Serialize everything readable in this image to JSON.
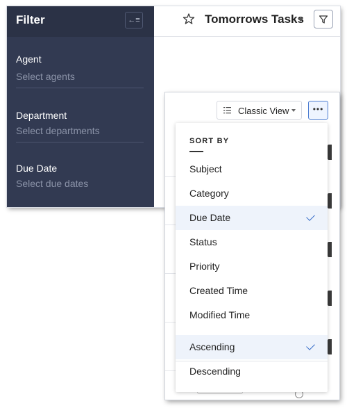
{
  "filter_panel": {
    "title": "Filter",
    "collapse_icon_text": "←≡",
    "fields": [
      {
        "label": "Agent",
        "placeholder": "Select agents"
      },
      {
        "label": "Department",
        "placeholder": "Select departments"
      },
      {
        "label": "Due Date",
        "placeholder": "Select due dates"
      }
    ]
  },
  "header": {
    "title": "Tomorrows Tasks",
    "star_icon": "star-icon",
    "filter_icon": "funnel-icon"
  },
  "toolbar": {
    "view_label": "Classic View",
    "more_label": "•••"
  },
  "sort_menu": {
    "heading": "SORT BY",
    "sort_fields": [
      {
        "label": "Subject",
        "selected": false
      },
      {
        "label": "Category",
        "selected": false
      },
      {
        "label": "Due Date",
        "selected": true
      },
      {
        "label": "Status",
        "selected": false
      },
      {
        "label": "Priority",
        "selected": false
      },
      {
        "label": "Created Time",
        "selected": false
      },
      {
        "label": "Modified Time",
        "selected": false
      }
    ],
    "order": [
      {
        "label": "Ascending",
        "selected": true
      },
      {
        "label": "Descending",
        "selected": false
      }
    ]
  },
  "colors": {
    "filter_bg": "#323a52",
    "filter_header_bg": "#2b3246",
    "accent": "#3a6fc9",
    "selected_row_bg": "#eef3fb"
  }
}
